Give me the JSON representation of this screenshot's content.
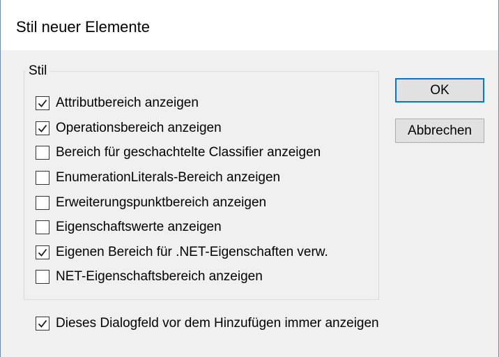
{
  "dialog": {
    "title": "Stil neuer Elemente"
  },
  "group": {
    "label": "Stil",
    "options": [
      {
        "label": "Attributbereich anzeigen",
        "checked": true
      },
      {
        "label": "Operationsbereich anzeigen",
        "checked": true
      },
      {
        "label": "Bereich für geschachtelte Classifier anzeigen",
        "checked": false
      },
      {
        "label": "EnumerationLiterals-Bereich anzeigen",
        "checked": false
      },
      {
        "label": "Erweiterungspunktbereich anzeigen",
        "checked": false
      },
      {
        "label": "Eigenschaftswerte anzeigen",
        "checked": false
      },
      {
        "label": "Eigenen Bereich für .NET-Eigenschaften verw.",
        "checked": true
      },
      {
        "label": "NET-Eigenschaftsbereich anzeigen",
        "checked": false
      }
    ]
  },
  "always_show": {
    "label": "Dieses Dialogfeld vor dem Hinzufügen immer anzeigen",
    "checked": true
  },
  "buttons": {
    "ok_label": "OK",
    "cancel_label": "Abbrechen"
  },
  "colors": {
    "accent": "#0078d7",
    "dialog_background": "#f0f0f0"
  }
}
